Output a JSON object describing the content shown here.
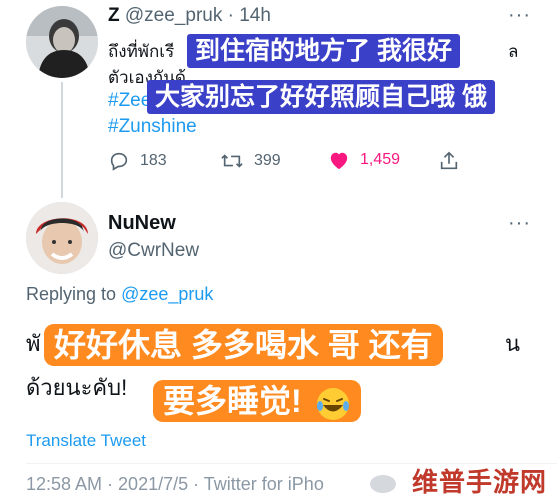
{
  "tweet1": {
    "author_name": "Z",
    "handle": "@zee_pruk",
    "separator": "·",
    "time": "14h",
    "more_glyph": "···",
    "text_line1": "ถึงที่พักเรี",
    "text_line1_tail": "ล",
    "text_line2": "ตัวเองกันด้",
    "hashtag1": "#Zee",
    "hashtag2": "#Zunshine",
    "replies": "183",
    "retweets": "399",
    "likes": "1,459",
    "like_color": "#f91880"
  },
  "tweet2": {
    "author_name": "NuNew",
    "handle": "@CwrNew",
    "more_glyph": "···",
    "replying_prefix": "Replying to",
    "replying_to": "@zee_pruk",
    "text_line1_head": "พั",
    "text_line1_tail": "น",
    "text_line2": "ด้วยนะคับ!",
    "translate_label": "Translate Tweet",
    "timestamp": "12:58 AM · 2021/7/5 · Twitter for iPho"
  },
  "captions": {
    "blue_line1": "到住宿的地方了 我很好",
    "blue_line2": "大家别忘了好好照顾自己哦 饿",
    "orange_line1": "好好休息 多多喝水 哥 还有",
    "orange_line2": "要多睡觉!",
    "orange_emoji": "laughing-tears-emoji",
    "blue_color": "#3b40c9",
    "orange_color": "#ff8a1f"
  },
  "watermark": {
    "text": "维普手游网",
    "color": "#c0392b"
  },
  "icons": {
    "reply": "reply-icon",
    "retweet": "retweet-icon",
    "like": "heart-icon",
    "share": "share-icon"
  }
}
